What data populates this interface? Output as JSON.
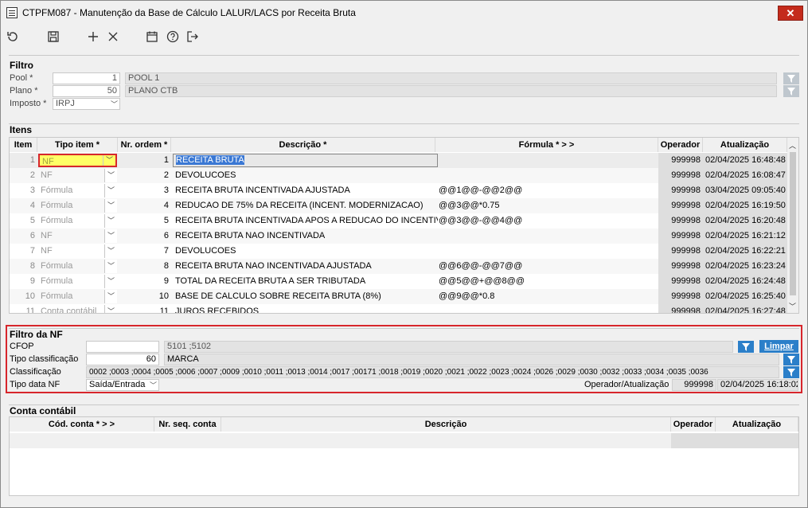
{
  "window": {
    "title": "CTPFM087 - Manutenção da Base de Cálculo LALUR/LACS por Receita Bruta"
  },
  "toolbar": {
    "icons": [
      "undo-icon",
      "save-icon",
      "add-icon",
      "delete-icon",
      "calendar-icon",
      "help-icon",
      "exit-icon"
    ]
  },
  "filtro": {
    "title": "Filtro",
    "pool_label": "Pool *",
    "pool_value": "1",
    "pool_desc": "POOL 1",
    "plano_label": "Plano *",
    "plano_value": "50",
    "plano_desc": "PLANO CTB",
    "imposto_label": "Imposto *",
    "imposto_value": "IRPJ"
  },
  "itens": {
    "title": "Itens",
    "headers": {
      "item": "Item",
      "tipo": "Tipo item *",
      "ordem": "Nr. ordem *",
      "descricao": "Descrição *",
      "formula": "Fórmula * > >",
      "operador": "Operador",
      "atualizacao": "Atualização"
    },
    "rows": [
      {
        "item": "1",
        "tipo": "NF",
        "ordem": "1",
        "descricao": "RECEITA BRUTA",
        "formula": "",
        "operador": "999998",
        "atualizacao": "02/04/2025 16:48:48"
      },
      {
        "item": "2",
        "tipo": "NF",
        "ordem": "2",
        "descricao": "DEVOLUCOES",
        "formula": "",
        "operador": "999998",
        "atualizacao": "02/04/2025 16:08:47"
      },
      {
        "item": "3",
        "tipo": "Fórmula",
        "ordem": "3",
        "descricao": "RECEITA BRUTA INCENTIVADA AJUSTADA",
        "formula": "@@1@@-@@2@@",
        "operador": "999998",
        "atualizacao": "03/04/2025 09:05:40"
      },
      {
        "item": "4",
        "tipo": "Fórmula",
        "ordem": "4",
        "descricao": "REDUCAO DE 75% DA RECEITA (INCENT. MODERNIZACAO)",
        "formula": "@@3@@*0.75",
        "operador": "999998",
        "atualizacao": "02/04/2025 16:19:50"
      },
      {
        "item": "5",
        "tipo": "Fórmula",
        "ordem": "5",
        "descricao": "RECEITA BRUTA INCENTIVADA APOS A REDUCAO DO INCENTIVO",
        "formula": "@@3@@-@@4@@",
        "operador": "999998",
        "atualizacao": "02/04/2025 16:20:48"
      },
      {
        "item": "6",
        "tipo": "NF",
        "ordem": "6",
        "descricao": "RECEITA BRUTA NAO INCENTIVADA",
        "formula": "",
        "operador": "999998",
        "atualizacao": "02/04/2025 16:21:12"
      },
      {
        "item": "7",
        "tipo": "NF",
        "ordem": "7",
        "descricao": "DEVOLUCOES",
        "formula": "",
        "operador": "999998",
        "atualizacao": "02/04/2025 16:22:21"
      },
      {
        "item": "8",
        "tipo": "Fórmula",
        "ordem": "8",
        "descricao": "RECEITA BRUTA NAO INCENTIVADA AJUSTADA",
        "formula": "@@6@@-@@7@@",
        "operador": "999998",
        "atualizacao": "02/04/2025 16:23:24"
      },
      {
        "item": "9",
        "tipo": "Fórmula",
        "ordem": "9",
        "descricao": "TOTAL DA RECEITA BRUTA A SER TRIBUTADA",
        "formula": "@@5@@+@@8@@",
        "operador": "999998",
        "atualizacao": "02/04/2025 16:24:48"
      },
      {
        "item": "10",
        "tipo": "Fórmula",
        "ordem": "10",
        "descricao": "BASE DE CALCULO SOBRE RECEITA BRUTA (8%)",
        "formula": "@@9@@*0.8",
        "operador": "999998",
        "atualizacao": "02/04/2025 16:25:40"
      },
      {
        "item": "11",
        "tipo": "Conta contábil",
        "ordem": "11",
        "descricao": "JUROS RECEBIDOS",
        "formula": "",
        "operador": "999998",
        "atualizacao": "02/04/2025 16:27:48"
      }
    ]
  },
  "filtro_nf": {
    "title": "Filtro da NF",
    "cfop_label": "CFOP",
    "cfop_value": "",
    "cfop_desc": "5101 ;5102",
    "limpar_label": "Limpar",
    "tipo_class_label": "Tipo classificação",
    "tipo_class_value": "60",
    "tipo_class_desc": "MARCA",
    "classif_label": "Classificação",
    "classif_value": "0002 ;0003 ;0004 ;0005 ;0006 ;0007 ;0009 ;0010 ;0011 ;0013 ;0014 ;0017 ;00171 ;0018 ;0019 ;0020 ;0021 ;0022 ;0023 ;0024 ;0026 ;0029 ;0030 ;0032 ;0033 ;0034 ;0035 ;0036",
    "tipo_data_label": "Tipo data NF",
    "tipo_data_value": "Saída/Entrada",
    "op_atual_label": "Operador/Atualização",
    "operador": "999998",
    "atualizacao": "02/04/2025 16:18:02"
  },
  "conta": {
    "title": "Conta contábil",
    "headers": {
      "cod": "Cód. conta * > >",
      "seq": "Nr. seq. conta",
      "descricao": "Descrição",
      "operador": "Operador",
      "atualizacao": "Atualização"
    }
  }
}
